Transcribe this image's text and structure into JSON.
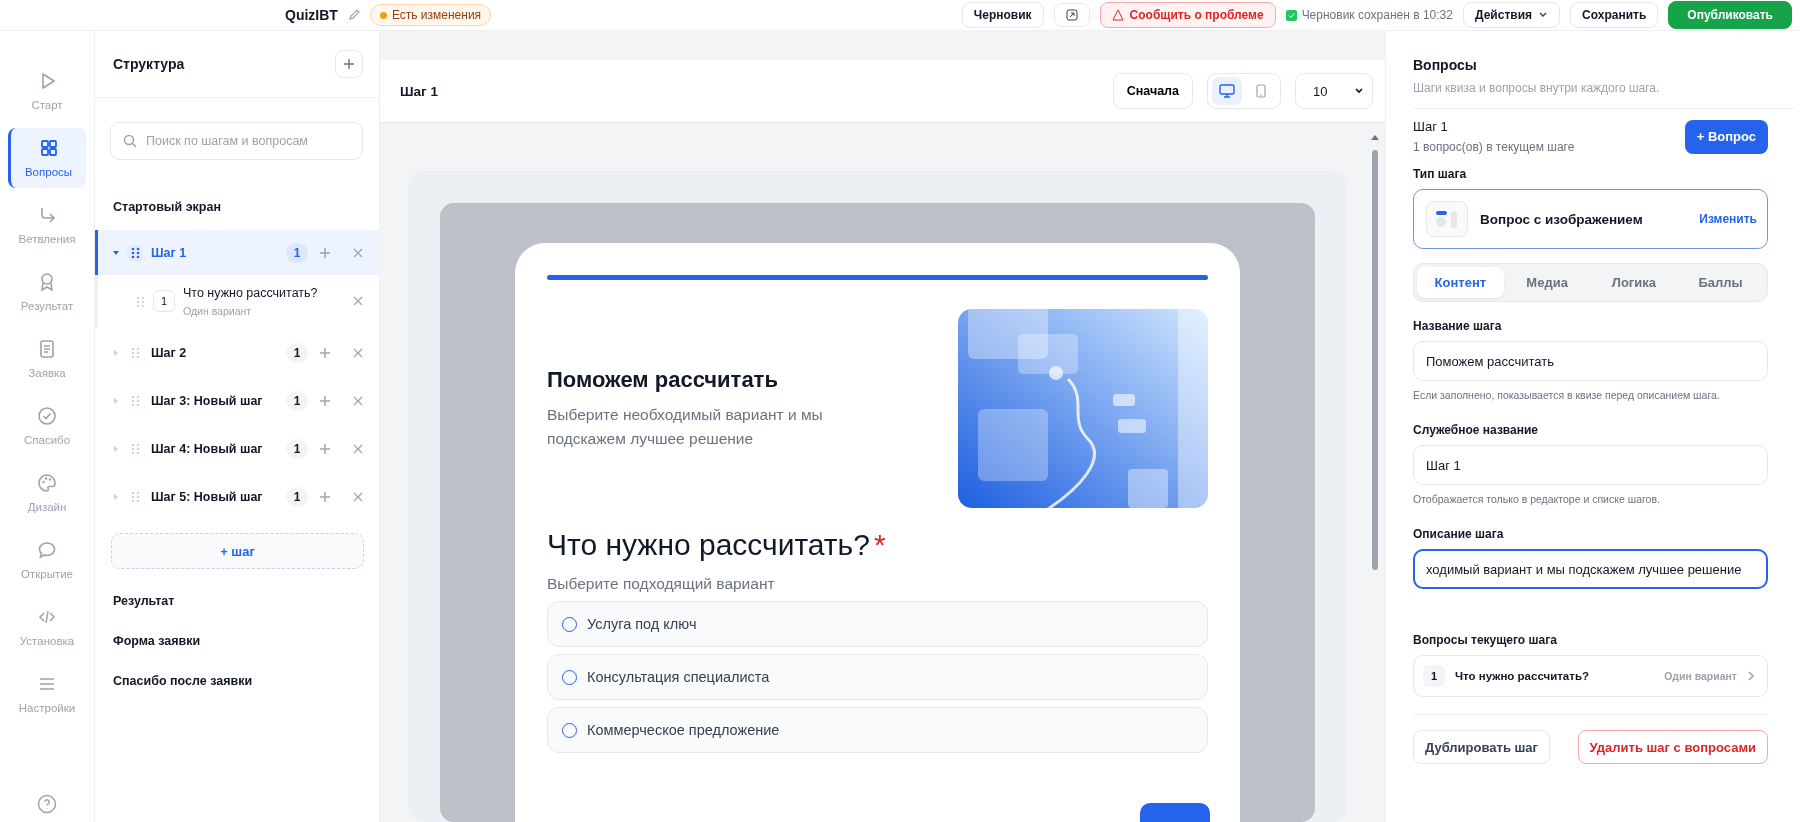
{
  "topbar": {
    "title": "QuizIBT",
    "changes_badge": "Есть изменения",
    "status_chip": "Черновик",
    "report_button": "Сообщить о проблеме",
    "saved_note": "Черновик сохранен в 10:32",
    "actions_button": "Действия",
    "save_button": "Сохранить",
    "publish_button": "Опубликовать"
  },
  "rail": {
    "items": [
      {
        "label": "Старт",
        "kind": "play",
        "selected": false
      },
      {
        "label": "Вопросы",
        "kind": "grid",
        "selected": true
      },
      {
        "label": "Ветвления",
        "kind": "branch",
        "selected": false
      },
      {
        "label": "Результат",
        "kind": "award",
        "selected": false
      },
      {
        "label": "Заявка",
        "kind": "form",
        "selected": false
      },
      {
        "label": "Спасибо",
        "kind": "check",
        "selected": false
      },
      {
        "label": "Дизайн",
        "kind": "palette",
        "selected": false
      },
      {
        "label": "Открытие",
        "kind": "chat",
        "selected": false
      },
      {
        "label": "Установка",
        "kind": "code",
        "selected": false
      },
      {
        "label": "Настройки",
        "kind": "menu",
        "selected": false
      }
    ]
  },
  "structure": {
    "title": "Структура",
    "search": {
      "placeholder": "Поиск по шагам и вопросам"
    },
    "start_screen": "Стартовый экран",
    "steps": [
      {
        "label": "Шаг 1",
        "count": "1",
        "selected": true,
        "expanded": true,
        "children": [
          {
            "number": "1",
            "title": "Что нужно рассчитать?",
            "subtitle": "Один вариант"
          }
        ]
      },
      {
        "label": "Шаг 2",
        "count": "1",
        "selected": false,
        "expanded": false
      },
      {
        "label": "Шаг 3: Новый шаг",
        "count": "1",
        "selected": false,
        "expanded": false
      },
      {
        "label": "Шаг 4: Новый шаг",
        "count": "1",
        "selected": false,
        "expanded": false
      },
      {
        "label": "Шаг 5: Новый шаг",
        "count": "1",
        "selected": false,
        "expanded": false
      }
    ],
    "add_step": "+ шаг",
    "sections": [
      "Результат",
      "Форма заявки",
      "Спасибо после заявки"
    ]
  },
  "preview": {
    "title": "Шаг 1",
    "restart_button": "Сначала",
    "devices": [
      {
        "kind": "desktop",
        "selected": true
      },
      {
        "kind": "mobile",
        "selected": false
      }
    ],
    "zoom": "10",
    "card": {
      "progress": {
        "level": 1
      },
      "heading": "Поможем рассчитать",
      "description": "Выберите необходимый вариант и мы подскажем лучшее решение",
      "question": "Что нужно рассчитать?",
      "required_mark": "*",
      "hint": "Выберите подходящий вариант",
      "options": [
        {
          "label": "Услуга под ключ",
          "selected": false
        },
        {
          "label": "Консультация специалиста",
          "selected": false
        },
        {
          "label": "Коммерческое предложение",
          "selected": false
        }
      ]
    }
  },
  "panel": {
    "title": "Вопросы",
    "subtitle": "Шаги квиза и вопросы внутри каждого шага.",
    "step_title": "Шаг 1",
    "step_count": "1 вопрос(ов) в текущем шаге",
    "add_question_button": "+ Вопрос",
    "type_label": "Тип шага",
    "type_name": "Вопрос с изображением",
    "type_change": "Изменить",
    "tabs": [
      {
        "label": "Контент",
        "selected": true
      },
      {
        "label": "Медиа",
        "selected": false
      },
      {
        "label": "Логика",
        "selected": false
      },
      {
        "label": "Баллы",
        "selected": false
      }
    ],
    "fields": [
      {
        "label": "Название шага",
        "value": "Поможем рассчитать",
        "hint": "Если заполнено, показывается в квизе перед описанием шага.",
        "focused": false
      },
      {
        "label": "Служебное название",
        "value": "Шаг 1",
        "hint": "Отображается только в редакторе и списке шагов.",
        "focused": false
      },
      {
        "label": "Описание шага",
        "value": "ходимый вариант и мы подскажем лучшее решение",
        "focused": true
      }
    ],
    "questions_label": "Вопросы текущего шага",
    "questions": [
      {
        "number": "1",
        "title": "Что нужно рассчитать?",
        "type": "Один вариант"
      }
    ],
    "duplicate_button": "Дублировать шаг",
    "delete_button": "Удалить шаг с вопросами"
  }
}
